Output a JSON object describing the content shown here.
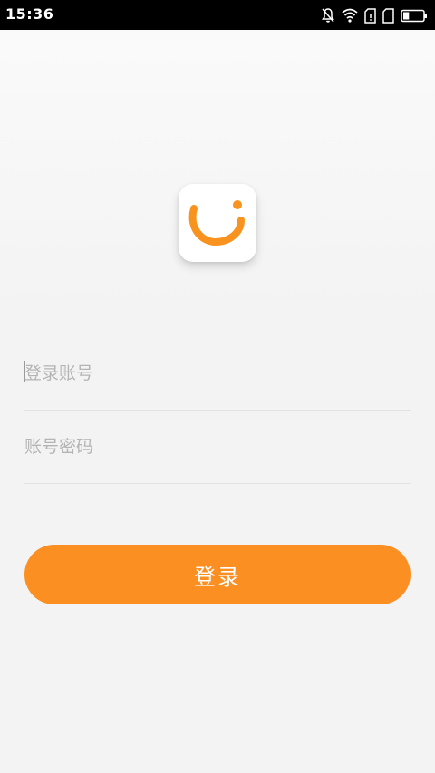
{
  "status_bar": {
    "time": "15:36",
    "icons": [
      "notification-off-icon",
      "wifi-icon",
      "sim1-signal-icon",
      "sim2-signal-icon",
      "battery-icon"
    ],
    "battery_level": 0.3
  },
  "logo": {
    "icon": "smile-logo-icon",
    "accent_color": "#F7931E"
  },
  "form": {
    "account_placeholder": "登录账号",
    "password_placeholder": "账号密码",
    "account_value": "",
    "password_value": ""
  },
  "login_button": {
    "label": "登录",
    "color": "#FB8F22"
  }
}
